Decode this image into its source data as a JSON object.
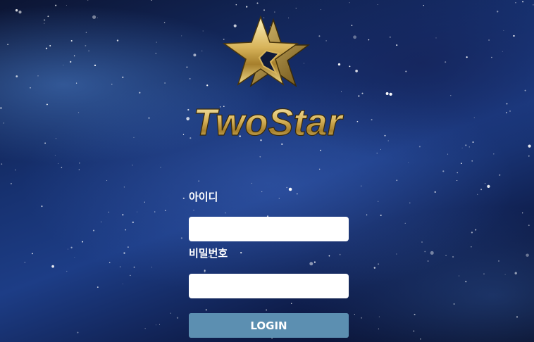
{
  "brand": {
    "logo_text": "TwoStar",
    "colors": {
      "gold_light": "#f6e6a3",
      "gold": "#c9a548",
      "gold_dark": "#7a5c1d"
    }
  },
  "login_form": {
    "id_label": "아이디",
    "id_value": "",
    "password_label": "비밀번호",
    "password_value": "",
    "submit_label": "LOGIN"
  },
  "colors": {
    "background_top": "#0c1533",
    "background_mid": "#1d3d86",
    "input_background": "#ffffff",
    "button_background": "#5c8fb1",
    "label_color": "#ffffff"
  }
}
